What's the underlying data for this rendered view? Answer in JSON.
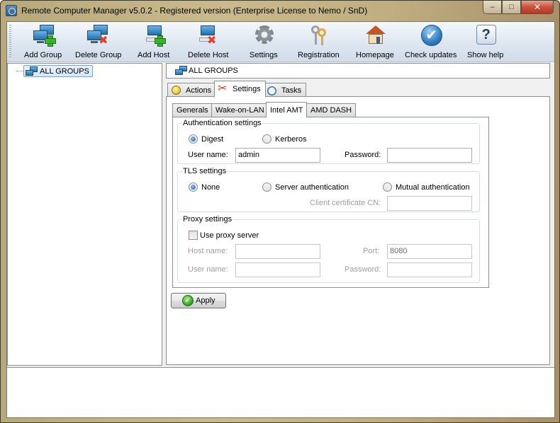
{
  "window": {
    "title": "Remote Computer Manager v5.0.2 - Registered version (Enterprise License to Nemo / SnD)",
    "controls": {
      "minimize": "–",
      "maximize": "□",
      "close": "✕"
    }
  },
  "toolbar": {
    "buttons": [
      {
        "label": "Add Group",
        "icon": "add-group-icon"
      },
      {
        "label": "Delete Group",
        "icon": "delete-group-icon"
      },
      {
        "label": "Add Host",
        "icon": "add-host-icon"
      },
      {
        "label": "Delete Host",
        "icon": "delete-host-icon"
      },
      {
        "label": "Settings",
        "icon": "gear-icon"
      },
      {
        "label": "Registration",
        "icon": "keys-icon"
      },
      {
        "label": "Homepage",
        "icon": "house-icon"
      },
      {
        "label": "Check updates",
        "icon": "checkmark-icon"
      },
      {
        "label": "Show help",
        "icon": "question-icon"
      }
    ]
  },
  "tree": {
    "root": "ALL GROUPS"
  },
  "main": {
    "header": "ALL GROUPS",
    "tabs": [
      {
        "label": "Actions",
        "icon": "bulb-icon"
      },
      {
        "label": "Settings",
        "icon": "tools-icon",
        "active": true
      },
      {
        "label": "Tasks",
        "icon": "stopwatch-icon"
      }
    ],
    "sub_tabs": [
      {
        "label": "Generals"
      },
      {
        "label": "Wake-on-LAN"
      },
      {
        "label": "Intel AMT",
        "active": true
      },
      {
        "label": "AMD DASH"
      }
    ],
    "auth": {
      "title": "Authentication settings",
      "digest": "Digest",
      "kerberos": "Kerberos",
      "selected": "Digest",
      "user_label": "User name:",
      "user_value": "admin",
      "password_label": "Password:",
      "password_value": ""
    },
    "tls": {
      "title": "TLS settings",
      "none": "None",
      "server": "Server authentication",
      "mutual": "Mutual authentication",
      "selected": "None",
      "cn_label": "Client certificate CN:",
      "cn_value": ""
    },
    "proxy": {
      "title": "Proxy settings",
      "use_proxy_label": "Use proxy server",
      "use_proxy_checked": false,
      "host_label": "Host name:",
      "host_value": "",
      "port_label": "Port:",
      "port_value": "8080",
      "user_label": "User name:",
      "user_value": "",
      "password_label": "Password:",
      "password_value": ""
    },
    "apply_label": "Apply"
  }
}
